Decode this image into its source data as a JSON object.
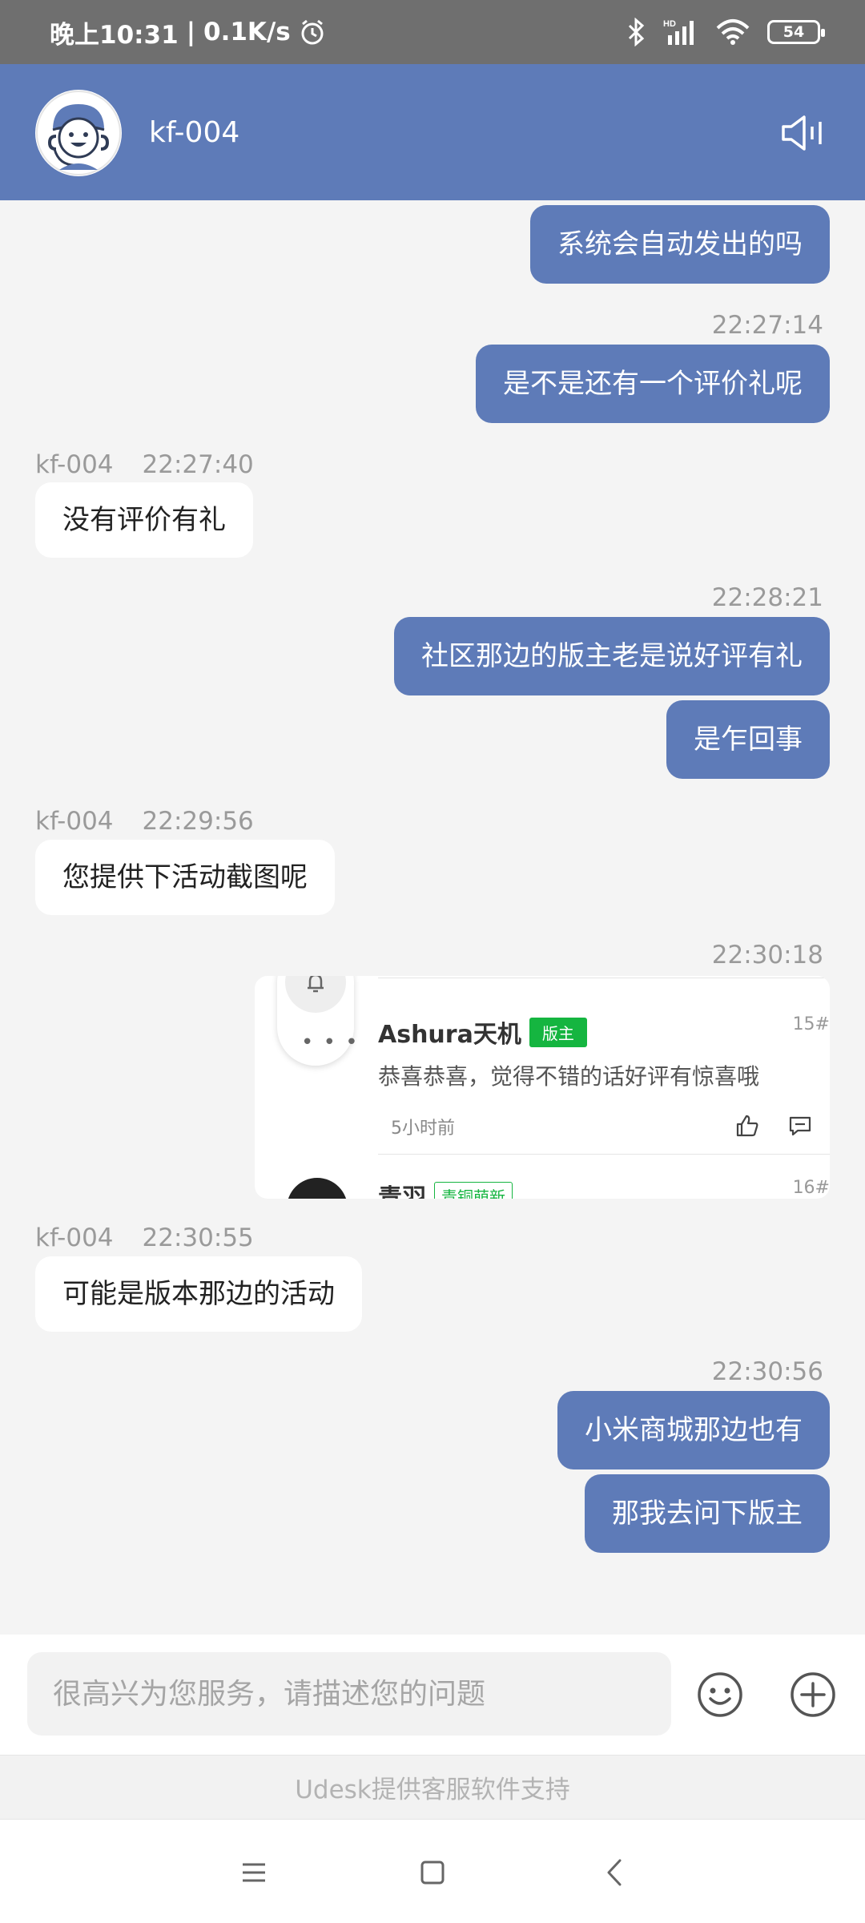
{
  "status_bar": {
    "time": "晚上10:31",
    "separator": "|",
    "speed": "0.1K/s",
    "battery": "54",
    "icons": [
      "alarm-icon",
      "bluetooth-icon",
      "hd-signal-icon",
      "wifi-icon",
      "battery-icon"
    ]
  },
  "header": {
    "agent_name": "kf-004",
    "bg_color": "#5e7bb8"
  },
  "messages": [
    {
      "direction": "out",
      "text": "系统会自动发出的吗"
    },
    {
      "direction": "out",
      "time": "22:27:14",
      "text": "是不是还有一个评价礼呢"
    },
    {
      "direction": "in",
      "sender": "kf-004",
      "time": "22:27:40",
      "text": "没有评价有礼"
    },
    {
      "direction": "out",
      "time": "22:28:21",
      "text": "社区那边的版主老是说好评有礼"
    },
    {
      "direction": "out",
      "text": "是乍回事"
    },
    {
      "direction": "in",
      "sender": "kf-004",
      "time": "22:29:56",
      "text": "您提供下活动截图呢"
    },
    {
      "direction": "out",
      "time": "22:30:18",
      "type": "image"
    },
    {
      "direction": "in",
      "sender": "kf-004",
      "time": "22:30:55",
      "text": "可能是版本那边的活动"
    },
    {
      "direction": "out",
      "time": "22:30:56",
      "text": "小米商城那边也有"
    },
    {
      "direction": "out",
      "text": "那我去问下版主"
    }
  ],
  "screenshot_image": {
    "user1": "Ashura天机",
    "user1_badge": "版主",
    "user1_floor": "15#",
    "user1_comment": "恭喜恭喜，觉得不错的话好评有惊喜哦",
    "user1_time": "5小时前",
    "user2": "青羽",
    "user2_badge": "青铜萌新",
    "user2_floor": "16#"
  },
  "input": {
    "placeholder": "很高兴为您服务，请描述您的问题"
  },
  "footer": {
    "powered_by": "Udesk提供客服软件支持"
  }
}
